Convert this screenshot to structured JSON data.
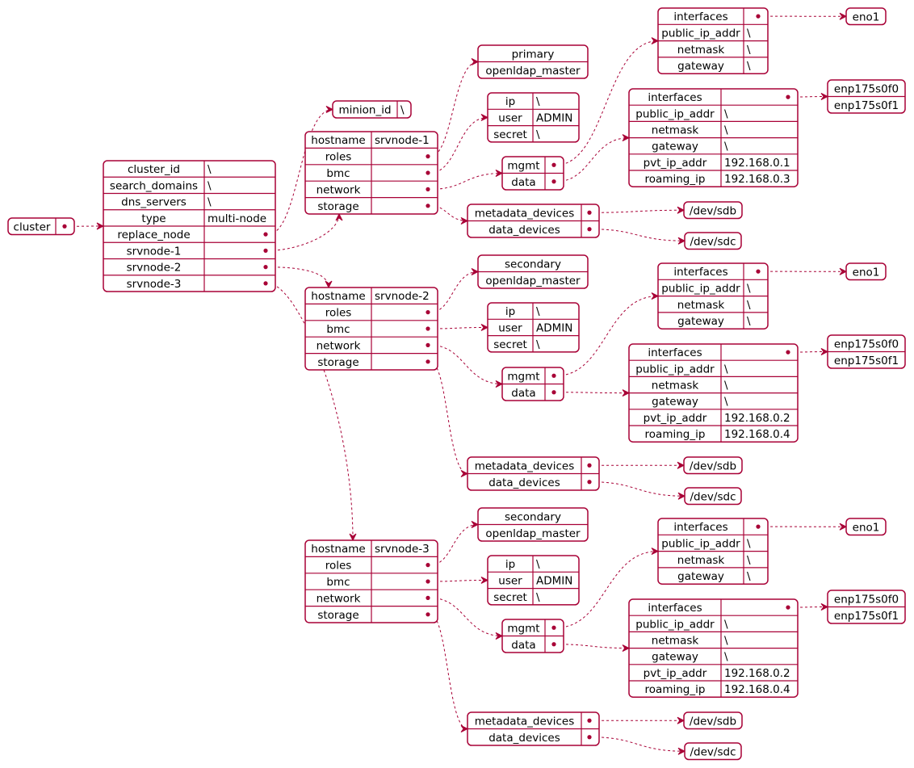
{
  "colors": {
    "border": "#A80036",
    "fill": "#FFFFFF",
    "text": "#000000"
  },
  "cluster_box": {
    "rows": [
      {
        "k": "cluster",
        "link": true
      }
    ]
  },
  "root": {
    "rows": [
      {
        "k": "cluster_id",
        "v": "\\"
      },
      {
        "k": "search_domains",
        "v": "\\"
      },
      {
        "k": "dns_servers",
        "v": "\\"
      },
      {
        "k": "type",
        "v": "multi-node"
      },
      {
        "k": "replace_node",
        "link": true
      },
      {
        "k": "srvnode-1",
        "link": true
      },
      {
        "k": "srvnode-2",
        "link": true
      },
      {
        "k": "srvnode-3",
        "link": true
      }
    ]
  },
  "replace_node": {
    "rows": [
      {
        "k": "minion_id",
        "v": "\\"
      }
    ]
  },
  "nodes": [
    {
      "host": {
        "rows": [
          {
            "k": "hostname",
            "v": "srvnode-1"
          },
          {
            "k": "roles",
            "link": true
          },
          {
            "k": "bmc",
            "link": true
          },
          {
            "k": "network",
            "link": true
          },
          {
            "k": "storage",
            "link": true
          }
        ]
      },
      "roles": {
        "rows": [
          {
            "k": "primary"
          },
          {
            "k": "openldap_master"
          }
        ]
      },
      "bmc": {
        "rows": [
          {
            "k": "ip",
            "v": "\\"
          },
          {
            "k": "user",
            "v": "ADMIN"
          },
          {
            "k": "secret",
            "v": "\\"
          }
        ]
      },
      "network": {
        "rows": [
          {
            "k": "mgmt",
            "link": true
          },
          {
            "k": "data",
            "link": true
          }
        ]
      },
      "mgmt": {
        "rows": [
          {
            "k": "interfaces",
            "link": true
          },
          {
            "k": "public_ip_addr",
            "v": "\\"
          },
          {
            "k": "netmask",
            "v": "\\"
          },
          {
            "k": "gateway",
            "v": "\\"
          }
        ]
      },
      "data": {
        "rows": [
          {
            "k": "interfaces",
            "link": true
          },
          {
            "k": "public_ip_addr",
            "v": "\\"
          },
          {
            "k": "netmask",
            "v": "\\"
          },
          {
            "k": "gateway",
            "v": "\\"
          },
          {
            "k": "pvt_ip_addr",
            "v": "192.168.0.1"
          },
          {
            "k": "roaming_ip",
            "v": "192.168.0.3"
          }
        ]
      },
      "mgmt_ifaces": {
        "rows": [
          {
            "k": "eno1"
          }
        ]
      },
      "data_ifaces": {
        "rows": [
          {
            "k": "enp175s0f0"
          },
          {
            "k": "enp175s0f1"
          }
        ]
      },
      "storage": {
        "rows": [
          {
            "k": "metadata_devices",
            "link": true
          },
          {
            "k": "data_devices",
            "link": true
          }
        ]
      },
      "metadata_devices": {
        "rows": [
          {
            "k": "/dev/sdb"
          }
        ]
      },
      "data_devices": {
        "rows": [
          {
            "k": "/dev/sdc"
          }
        ]
      }
    },
    {
      "host": {
        "rows": [
          {
            "k": "hostname",
            "v": "srvnode-2"
          },
          {
            "k": "roles",
            "link": true
          },
          {
            "k": "bmc",
            "link": true
          },
          {
            "k": "network",
            "link": true
          },
          {
            "k": "storage",
            "link": true
          }
        ]
      },
      "roles": {
        "rows": [
          {
            "k": "secondary"
          },
          {
            "k": "openldap_master"
          }
        ]
      },
      "bmc": {
        "rows": [
          {
            "k": "ip",
            "v": "\\"
          },
          {
            "k": "user",
            "v": "ADMIN"
          },
          {
            "k": "secret",
            "v": "\\"
          }
        ]
      },
      "network": {
        "rows": [
          {
            "k": "mgmt",
            "link": true
          },
          {
            "k": "data",
            "link": true
          }
        ]
      },
      "mgmt": {
        "rows": [
          {
            "k": "interfaces",
            "link": true
          },
          {
            "k": "public_ip_addr",
            "v": "\\"
          },
          {
            "k": "netmask",
            "v": "\\"
          },
          {
            "k": "gateway",
            "v": "\\"
          }
        ]
      },
      "data": {
        "rows": [
          {
            "k": "interfaces",
            "link": true
          },
          {
            "k": "public_ip_addr",
            "v": "\\"
          },
          {
            "k": "netmask",
            "v": "\\"
          },
          {
            "k": "gateway",
            "v": "\\"
          },
          {
            "k": "pvt_ip_addr",
            "v": "192.168.0.2"
          },
          {
            "k": "roaming_ip",
            "v": "192.168.0.4"
          }
        ]
      },
      "mgmt_ifaces": {
        "rows": [
          {
            "k": "eno1"
          }
        ]
      },
      "data_ifaces": {
        "rows": [
          {
            "k": "enp175s0f0"
          },
          {
            "k": "enp175s0f1"
          }
        ]
      },
      "storage": {
        "rows": [
          {
            "k": "metadata_devices",
            "link": true
          },
          {
            "k": "data_devices",
            "link": true
          }
        ]
      },
      "metadata_devices": {
        "rows": [
          {
            "k": "/dev/sdb"
          }
        ]
      },
      "data_devices": {
        "rows": [
          {
            "k": "/dev/sdc"
          }
        ]
      }
    },
    {
      "host": {
        "rows": [
          {
            "k": "hostname",
            "v": "srvnode-3"
          },
          {
            "k": "roles",
            "link": true
          },
          {
            "k": "bmc",
            "link": true
          },
          {
            "k": "network",
            "link": true
          },
          {
            "k": "storage",
            "link": true
          }
        ]
      },
      "roles": {
        "rows": [
          {
            "k": "secondary"
          },
          {
            "k": "openldap_master"
          }
        ]
      },
      "bmc": {
        "rows": [
          {
            "k": "ip",
            "v": "\\"
          },
          {
            "k": "user",
            "v": "ADMIN"
          },
          {
            "k": "secret",
            "v": "\\"
          }
        ]
      },
      "network": {
        "rows": [
          {
            "k": "mgmt",
            "link": true
          },
          {
            "k": "data",
            "link": true
          }
        ]
      },
      "mgmt": {
        "rows": [
          {
            "k": "interfaces",
            "link": true
          },
          {
            "k": "public_ip_addr",
            "v": "\\"
          },
          {
            "k": "netmask",
            "v": "\\"
          },
          {
            "k": "gateway",
            "v": "\\"
          }
        ]
      },
      "data": {
        "rows": [
          {
            "k": "interfaces",
            "link": true
          },
          {
            "k": "public_ip_addr",
            "v": "\\"
          },
          {
            "k": "netmask",
            "v": "\\"
          },
          {
            "k": "gateway",
            "v": "\\"
          },
          {
            "k": "pvt_ip_addr",
            "v": "192.168.0.2"
          },
          {
            "k": "roaming_ip",
            "v": "192.168.0.4"
          }
        ]
      },
      "mgmt_ifaces": {
        "rows": [
          {
            "k": "eno1"
          }
        ]
      },
      "data_ifaces": {
        "rows": [
          {
            "k": "enp175s0f0"
          },
          {
            "k": "enp175s0f1"
          }
        ]
      },
      "storage": {
        "rows": [
          {
            "k": "metadata_devices",
            "link": true
          },
          {
            "k": "data_devices",
            "link": true
          }
        ]
      },
      "metadata_devices": {
        "rows": [
          {
            "k": "/dev/sdb"
          }
        ]
      },
      "data_devices": {
        "rows": [
          {
            "k": "/dev/sdc"
          }
        ]
      }
    }
  ]
}
